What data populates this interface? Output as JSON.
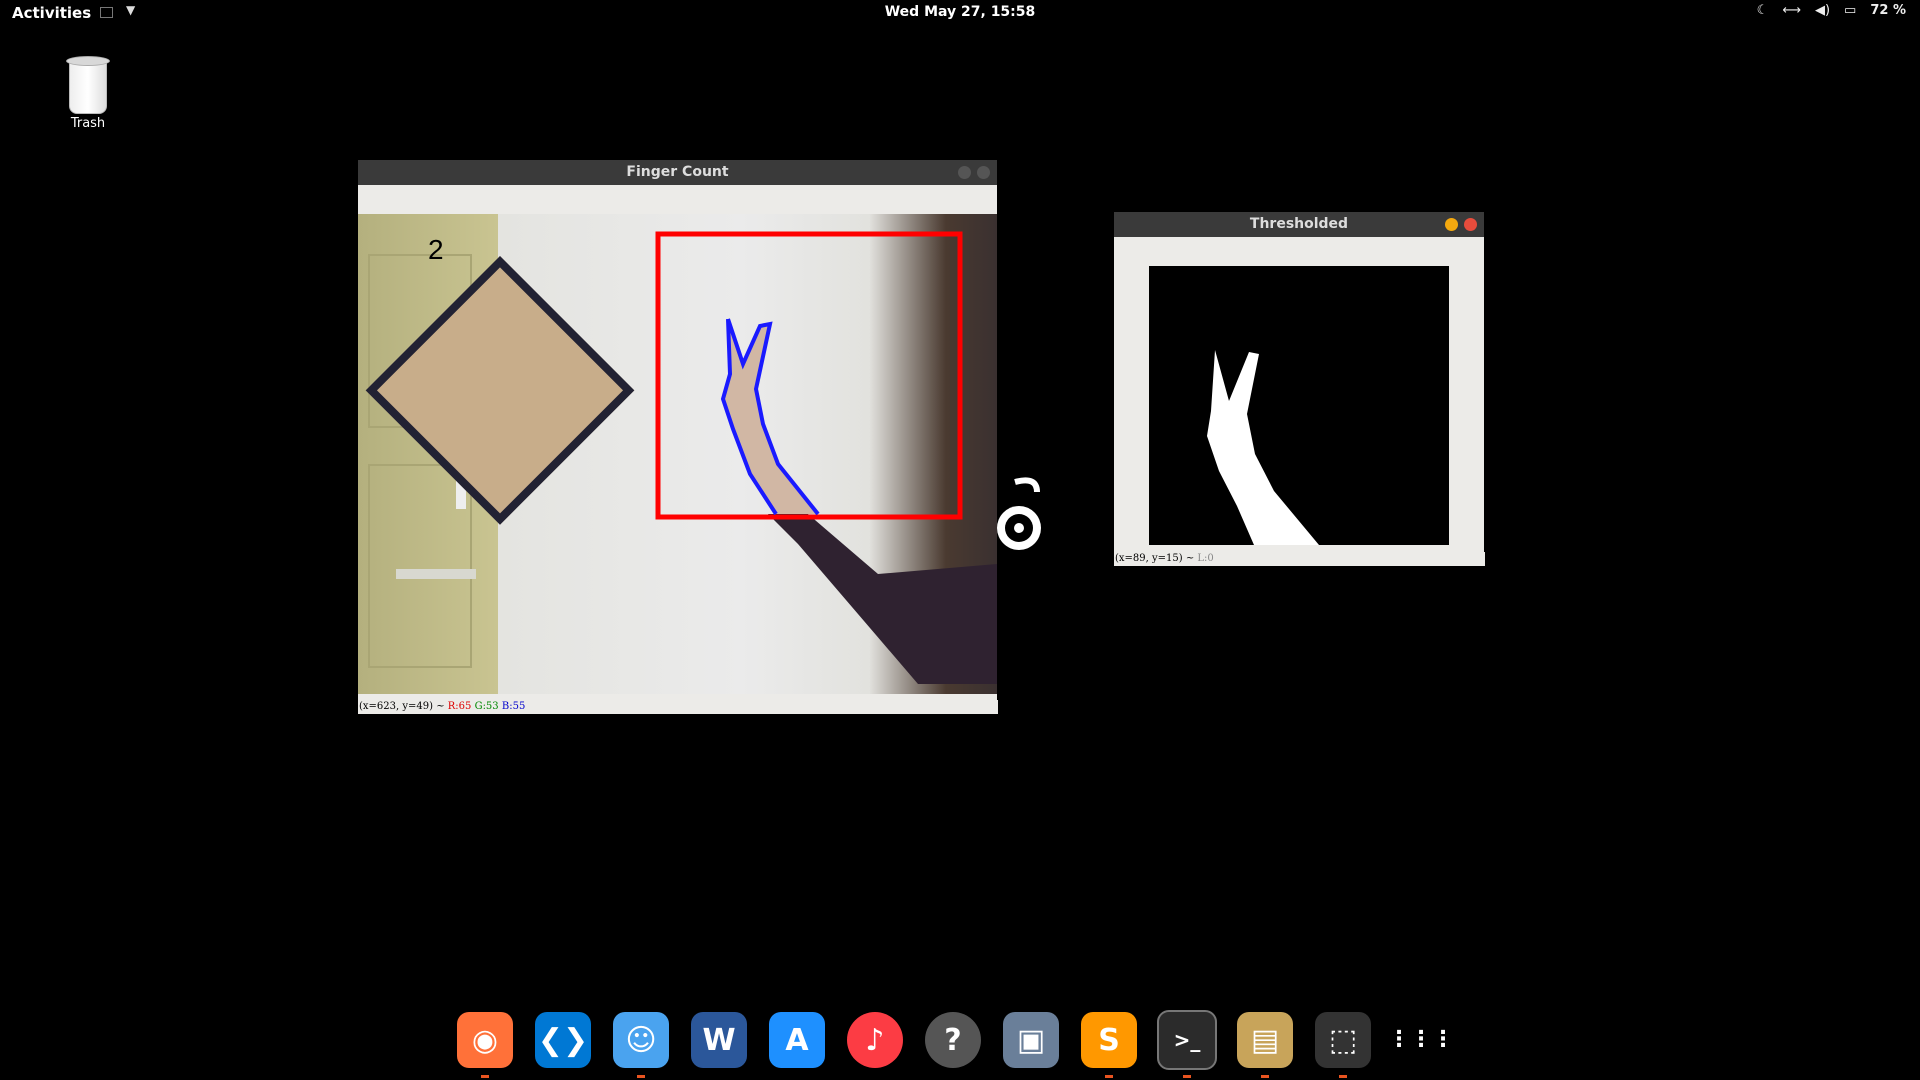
{
  "topbar": {
    "activities": "Activities",
    "clock": "Wed May 27, 15:58",
    "battery": "72 %"
  },
  "desktop": {
    "trash_label": "Trash"
  },
  "finger_window": {
    "title": "Finger Count",
    "count": "2",
    "status": {
      "coords": "(x=623, y=49) ~ ",
      "r": "R:65",
      "g": "G:53",
      "b": "B:55"
    }
  },
  "thresh_window": {
    "title": "Thresholded",
    "status": {
      "coords": "(x=89, y=15) ~ ",
      "l": "L:0"
    }
  },
  "colors": {
    "roi_box": "#ff0000",
    "contour": "#1a1aff",
    "close_active": "#e74c3c",
    "minimize_active": "#f4a90f",
    "accent": "#e95420"
  },
  "dock": [
    {
      "name": "Firefox",
      "icon": "firefox-icon",
      "color": "#ff7139",
      "running": true
    },
    {
      "name": "Visual Studio Code",
      "icon": "vscode-icon",
      "color": "#0078d4",
      "running": false
    },
    {
      "name": "Files",
      "icon": "finder-icon",
      "color": "#4aa3ef",
      "running": true
    },
    {
      "name": "Writer",
      "icon": "word-icon",
      "color": "#2b579a",
      "running": false
    },
    {
      "name": "Software",
      "icon": "app-store-icon",
      "color": "#1e90ff",
      "running": false
    },
    {
      "name": "Music",
      "icon": "music-icon",
      "color": "#fc3c44",
      "running": false
    },
    {
      "name": "Help",
      "icon": "help-icon",
      "color": "#555555",
      "running": false
    },
    {
      "name": "Image Viewer",
      "icon": "image-viewer-icon",
      "color": "#6a7f99",
      "running": false
    },
    {
      "name": "Sublime Text",
      "icon": "sublime-icon",
      "color": "#ff9800",
      "running": true
    },
    {
      "name": "Terminal",
      "icon": "terminal-icon",
      "color": "#2b2b2b",
      "running": true
    },
    {
      "name": "Archive Manager",
      "icon": "archive-icon",
      "color": "#c8a45a",
      "running": true
    },
    {
      "name": "Screenshot",
      "icon": "screenshot-icon",
      "color": "#333333",
      "running": true
    },
    {
      "name": "Show Applications",
      "icon": "app-grid-icon",
      "color": "#000000",
      "running": false
    }
  ]
}
